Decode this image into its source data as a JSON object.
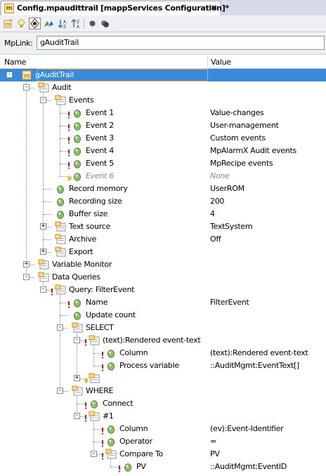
{
  "tab": {
    "title": "Config.mpaudittrail [mappServices Configuration]*",
    "close": "✖",
    "icon": "m"
  },
  "toolbar": {
    "buttons": [
      {
        "name": "new-config-icon"
      },
      {
        "name": "lightbulb-icon"
      },
      {
        "name": "navigate-icon"
      },
      {
        "name": "links-icon"
      },
      {
        "name": "sort-ascending-icon"
      },
      {
        "name": "sort-descending-icon"
      },
      {
        "name": "record-icon"
      },
      {
        "name": "multi-record-icon"
      }
    ]
  },
  "mplink": {
    "label": "MpLink:",
    "value": "gAuditTrail"
  },
  "columns": {
    "name": "Name",
    "value": "Value"
  },
  "tree": [
    {
      "label": "gAuditTrail",
      "value": "",
      "icon": "folder",
      "depth": 0,
      "expander": "-",
      "selected": true
    },
    {
      "label": "Audit",
      "value": "",
      "icon": "folder",
      "depth": 1,
      "expander": "-"
    },
    {
      "label": "Events",
      "value": "",
      "icon": "folder",
      "depth": 2,
      "expander": "-"
    },
    {
      "label": "Event 1",
      "value": "Value-changes",
      "icon": "param",
      "depth": 3,
      "marker": true
    },
    {
      "label": "Event 2",
      "value": "User-management",
      "icon": "param",
      "depth": 3,
      "marker": true
    },
    {
      "label": "Event 3",
      "value": "Custom events",
      "icon": "param",
      "depth": 3,
      "marker": true
    },
    {
      "label": "Event 4",
      "value": "MpAlarmX Audit events",
      "icon": "param",
      "depth": 3,
      "marker": true
    },
    {
      "label": "Event 5",
      "value": "MpRecipe events",
      "icon": "param",
      "depth": 3,
      "marker": true
    },
    {
      "label": "Event 6",
      "value": "None",
      "icon": "param",
      "depth": 3,
      "marker": true,
      "disabled": true,
      "markerKind": "star"
    },
    {
      "label": "Record memory",
      "value": "UserROM",
      "icon": "param",
      "depth": 2
    },
    {
      "label": "Recording size",
      "value": "200",
      "icon": "param",
      "depth": 2
    },
    {
      "label": "Buffer size",
      "value": "4",
      "icon": "param",
      "depth": 2
    },
    {
      "label": "Text source",
      "value": "TextSystem",
      "icon": "folder",
      "depth": 2,
      "expander": "+"
    },
    {
      "label": "Archive",
      "value": "Off",
      "icon": "folder",
      "depth": 2
    },
    {
      "label": "Export",
      "value": "",
      "icon": "folder",
      "depth": 2,
      "expander": "+"
    },
    {
      "label": "Variable Monitor",
      "value": "",
      "icon": "folder",
      "depth": 1,
      "expander": "+"
    },
    {
      "label": "Data Queries",
      "value": "",
      "icon": "folder",
      "depth": 1,
      "expander": "-"
    },
    {
      "label": "Query: FilterEvent",
      "value": "",
      "icon": "folder",
      "depth": 2,
      "expander": "-",
      "marker": true
    },
    {
      "label": "Name",
      "value": "FilterEvent",
      "icon": "param",
      "depth": 3,
      "marker": true
    },
    {
      "label": "Update count",
      "value": "",
      "icon": "param",
      "depth": 3
    },
    {
      "label": "SELECT",
      "value": "",
      "icon": "folder",
      "depth": 3,
      "expander": "-"
    },
    {
      "label": "(text):Rendered event-text",
      "value": "",
      "icon": "folder",
      "depth": 4,
      "expander": "-",
      "marker": true
    },
    {
      "label": "Column",
      "value": "(text):Rendered event-text",
      "icon": "param",
      "depth": 5,
      "marker": true
    },
    {
      "label": "Process variable",
      "value": "::AuditMgmt:EventText[]",
      "icon": "param",
      "depth": 5,
      "marker": true
    },
    {
      "label": "",
      "value": "",
      "icon": "folder",
      "depth": 4,
      "expander": "+",
      "markerKind": "star"
    },
    {
      "label": "WHERE",
      "value": "",
      "icon": "folder",
      "depth": 3,
      "expander": "-"
    },
    {
      "label": "Connect",
      "value": "",
      "icon": "param",
      "depth": 4,
      "marker": true
    },
    {
      "label": "#1",
      "value": "",
      "icon": "folder",
      "depth": 4,
      "expander": "-",
      "marker": true
    },
    {
      "label": "Column",
      "value": "(ev):Event-Identifier",
      "icon": "param",
      "depth": 5,
      "marker": true
    },
    {
      "label": "Operator",
      "value": "=",
      "icon": "param",
      "depth": 5,
      "marker": true
    },
    {
      "label": "Compare To",
      "value": "PV",
      "icon": "folder",
      "depth": 5,
      "expander": "-",
      "marker": true
    },
    {
      "label": "PV",
      "value": "::AuditMgmt:EventID",
      "icon": "param",
      "depth": 6,
      "marker": true
    }
  ]
}
